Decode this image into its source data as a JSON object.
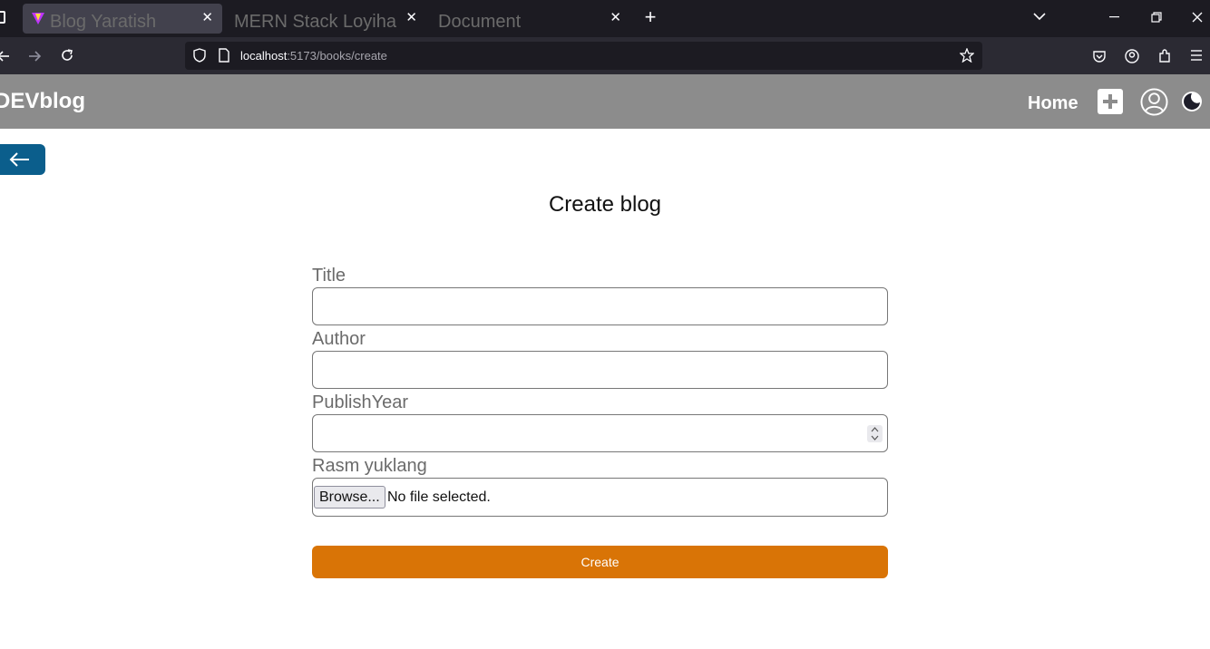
{
  "browser": {
    "tabs": [
      {
        "label": "Blog Yaratish",
        "active": true
      },
      {
        "label": "MERN Stack Loyiha",
        "active": false
      },
      {
        "label": "Document",
        "active": false
      }
    ],
    "close_glyph": "✕",
    "new_tab_glyph": "+",
    "url_host": "localhost",
    "url_rest": ":5173/books/create"
  },
  "header": {
    "brand": "DEVblog",
    "home": "Home"
  },
  "page": {
    "title": "Create blog"
  },
  "form": {
    "title_label": "Title",
    "author_label": "Author",
    "year_label": "PublishYear",
    "image_label": "Rasm yuklang",
    "browse_label": "Browse...",
    "no_file": "No file selected.",
    "submit": "Create"
  },
  "colors": {
    "header_bg": "#8c8c8c",
    "back_button": "#0b5e8c",
    "create_button": "#d97406"
  }
}
